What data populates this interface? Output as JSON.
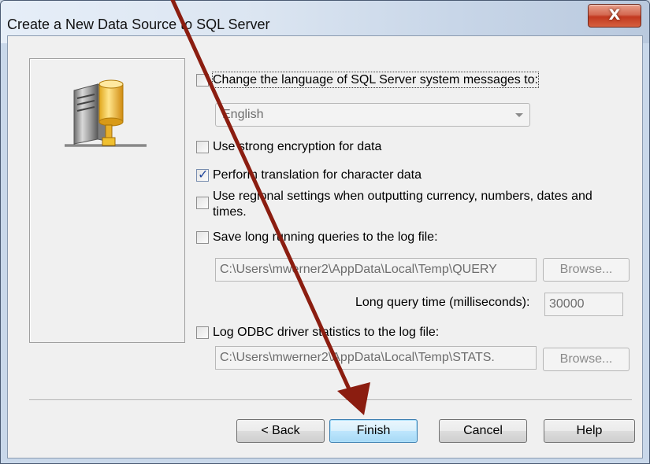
{
  "window": {
    "title": "Create a New Data Source to SQL Server",
    "close_symbol": "X"
  },
  "icons": {
    "close": "close-icon",
    "server": "server-database-icon",
    "dropdown": "chevron-down-icon",
    "annotation": "red-arrow-annotation"
  },
  "options": {
    "change_language": {
      "label": "Change the language of SQL Server system messages to:",
      "checked": false
    },
    "language_select": {
      "value": "English"
    },
    "strong_encryption": {
      "label": "Use strong encryption for data",
      "checked": false
    },
    "translation": {
      "label": "Perform translation for character data",
      "checked": true
    },
    "regional": {
      "label_line1": "Use regional settings when outputting currency, numbers, dates and",
      "label_line2": "times.",
      "checked": false
    },
    "long_queries": {
      "label": "Save long running queries to the log file:",
      "checked": false
    },
    "query_log_path": "C:\\Users\\mwerner2\\AppData\\Local\\Temp\\QUERY",
    "long_query_time_label": "Long query time (milliseconds):",
    "long_query_time_value": "30000",
    "odbc_stats": {
      "label": "Log ODBC driver statistics to the log file:",
      "checked": false
    },
    "stats_log_path": "C:\\Users\\mwerner2\\AppData\\Local\\Temp\\STATS.",
    "browse_label": "Browse...",
    "browse_label_2": "Browse..."
  },
  "buttons": {
    "back": "< Back",
    "finish": "Finish",
    "cancel": "Cancel",
    "help": "Help"
  },
  "colors": {
    "annotation_arrow": "#8b1d10",
    "checkmark": "#21469c"
  }
}
